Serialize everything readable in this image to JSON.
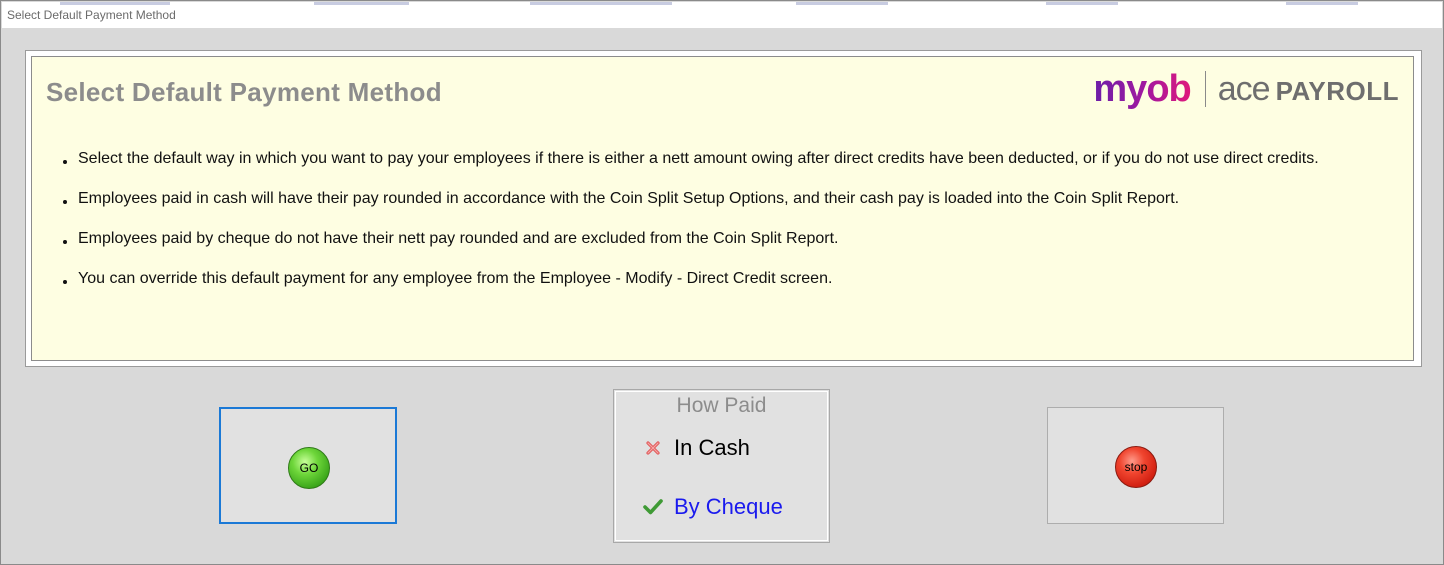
{
  "window": {
    "title": "Select Default Payment Method"
  },
  "info": {
    "heading": "Select Default Payment Method",
    "logo": {
      "brand": "myob",
      "product_a": "ace",
      "product_b": "PAYROLL"
    },
    "bullets": [
      "Select the default way in which you want to pay your employees if there is either a nett amount owing after direct credits have been deducted, or if you do not use direct credits.",
      "Employees paid in cash will have their pay rounded in accordance with the Coin Split Setup Options, and their cash pay is loaded into the Coin Split Report.",
      "Employees paid by cheque do not have their nett pay rounded and are excluded from the Coin Split Report.",
      "You can override this default payment for any employee from the Employee - Modify - Direct Credit screen."
    ]
  },
  "actions": {
    "go_label": "GO",
    "stop_label": "stop"
  },
  "how_paid": {
    "title": "How Paid",
    "options": [
      {
        "label": "In Cash",
        "state": "unselected",
        "icon": "cross-icon"
      },
      {
        "label": "By Cheque",
        "state": "selected",
        "icon": "checkmark-icon"
      }
    ]
  },
  "colors": {
    "panel_background": "#fefee2",
    "window_background": "#d9d9d9",
    "go_focus_border": "#1b79d6",
    "go_green": "#3aa51a",
    "stop_red": "#d01e10",
    "selected_option_text": "#1a1aee",
    "heading_grey": "#8c8c8c"
  }
}
